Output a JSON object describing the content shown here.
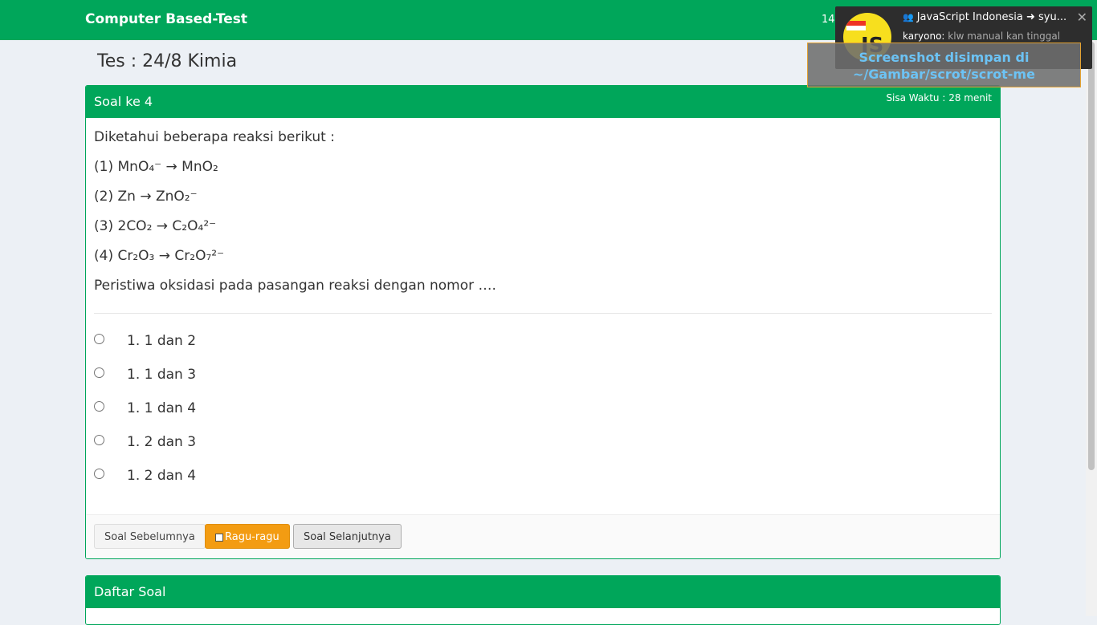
{
  "navbar": {
    "brand": "Computer Based-Test",
    "right_text": "14."
  },
  "page_title": "Tes : 24/8 Kimia",
  "question_panel": {
    "title": "Soal ke 4",
    "timer": "Sisa Waktu : 28 menit",
    "intro": "Diketahui beberapa reaksi berikut :",
    "reactions": [
      {
        "n": "(1)",
        "formula": "MnO₄⁻ → MnO₂"
      },
      {
        "n": "(2)",
        "formula": "Zn → ZnO₂⁻"
      },
      {
        "n": "(3)",
        "formula": "2CO₂ → C₂O₄²⁻"
      },
      {
        "n": "(4)",
        "formula": "Cr₂O₃ → Cr₂O₇²⁻"
      }
    ],
    "question": "Peristiwa oksidasi pada pasangan reaksi dengan nomor ….",
    "options": [
      "1. 1 dan 2",
      "1. 1 dan 3",
      "1. 1 dan 4",
      "1. 2 dan 3",
      "1. 2 dan 4"
    ]
  },
  "footer_buttons": {
    "prev": "Soal Sebelumnya",
    "doubt": "Ragu-ragu",
    "next": "Soal Selanjutnya"
  },
  "list_panel": {
    "title": "Daftar Soal"
  },
  "notification": {
    "title": "JavaScript Indonesia ➜ syu...",
    "sender": "karyono:",
    "message": "klw manual kan tinggal"
  },
  "toast": {
    "text": "Screenshot disimpan di ~/Gambar/scrot/scrot-me"
  },
  "colors": {
    "primary": "#00a65a",
    "warning": "#f39c12",
    "background": "#ecf0f5"
  }
}
